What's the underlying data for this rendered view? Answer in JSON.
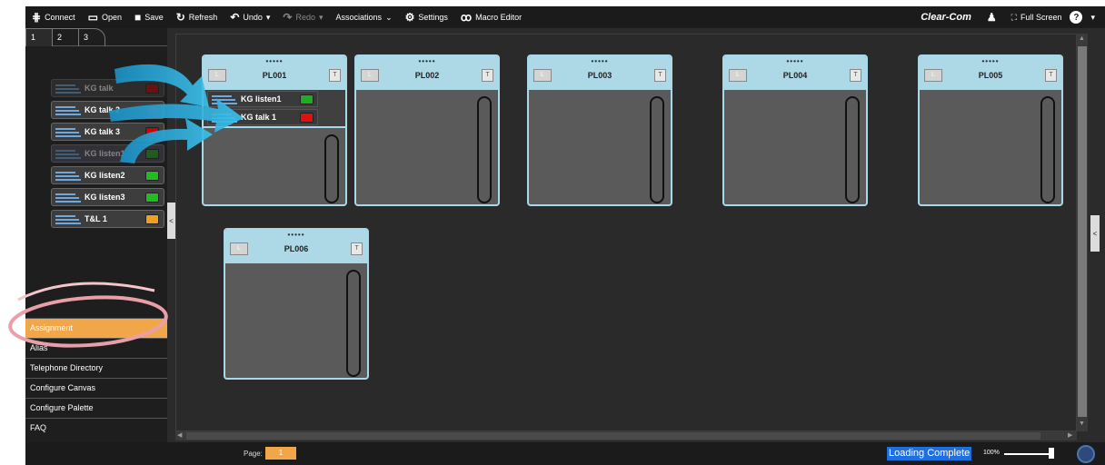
{
  "toolbar": {
    "items": [
      {
        "label": "Connect",
        "icon": "connect-icon"
      },
      {
        "label": "Open",
        "icon": "folder-icon"
      },
      {
        "label": "Save",
        "icon": "save-icon"
      },
      {
        "label": "Refresh",
        "icon": "refresh-icon"
      },
      {
        "label": "Undo",
        "icon": "undo-icon"
      },
      {
        "label": "Redo",
        "icon": "redo-icon"
      },
      {
        "label": "Associations",
        "icon": "chevron-down-icon"
      },
      {
        "label": "Settings",
        "icon": "gear-icon"
      },
      {
        "label": "Macro Editor",
        "icon": "macro-icon"
      }
    ],
    "brand": "Clear-Com",
    "fullscreen_label": "Full Screen",
    "help": "?"
  },
  "left_panel": {
    "tabs": [
      "1",
      "2",
      "3"
    ],
    "palette": [
      {
        "label": "KG talk",
        "led": "#cc0000",
        "state": "dim"
      },
      {
        "label": "KG talk 2",
        "led": "#e01010",
        "state": "normal"
      },
      {
        "label": "KG talk 3",
        "led": "#cc0000",
        "state": "normal"
      },
      {
        "label": "KG listen1",
        "led": "#22aa22",
        "state": "dim-highlight"
      },
      {
        "label": "KG listen2",
        "led": "#22bb22",
        "state": "normal"
      },
      {
        "label": "KG listen3",
        "led": "#22bb22",
        "state": "normal"
      },
      {
        "label": "T&L 1",
        "led": "#f0a020",
        "state": "normal"
      }
    ],
    "menu": [
      "Assignment",
      "Alias",
      "Telephone Directory",
      "Configure Canvas",
      "Configure Palette",
      "FAQ"
    ],
    "active_menu": "Assignment"
  },
  "canvas": {
    "cards": [
      {
        "title": "PL001",
        "dots": "•••••",
        "l": "L",
        "t": "T",
        "assigned": [
          {
            "label": "KG listen1",
            "led": "#22aa22"
          },
          {
            "label": "KG talk 1",
            "led": "#e01010"
          }
        ]
      },
      {
        "title": "PL002",
        "dots": "•••••",
        "l": "L",
        "t": "T"
      },
      {
        "title": "PL003",
        "dots": "•••••",
        "l": "L",
        "t": "T"
      },
      {
        "title": "PL004",
        "dots": "•••••",
        "l": "L",
        "t": "T"
      },
      {
        "title": "PL005",
        "dots": "•••••",
        "l": "L",
        "t": "T"
      },
      {
        "title": "PL006",
        "dots": "•••••",
        "l": "L",
        "t": "T"
      }
    ]
  },
  "statusbar": {
    "page_label": "Page:",
    "page_value": "1",
    "status": "Loading Complete",
    "zoom": "100%"
  },
  "colors": {
    "accent": "#f2a64a",
    "card_header": "#add8e6",
    "status_highlight": "#1e6fe0",
    "arrow": "#2aa7d6"
  }
}
